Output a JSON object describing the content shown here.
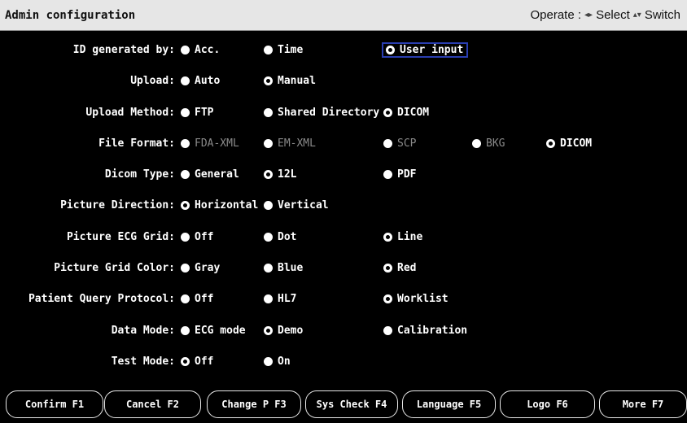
{
  "header": {
    "title": "Admin configuration",
    "operate_label": "Operate :",
    "select_label": "Select",
    "switch_label": "Switch",
    "select_icon": "left-right-arrows-icon",
    "switch_icon": "up-down-arrows-icon"
  },
  "settings": [
    {
      "label": "ID generated by:",
      "options": [
        {
          "text": "Acc.",
          "state": "filled"
        },
        {
          "text": "Time",
          "state": "filled"
        },
        {
          "text": "User input",
          "state": "selected",
          "focused": true
        }
      ]
    },
    {
      "label": "Upload:",
      "options": [
        {
          "text": "Auto",
          "state": "filled"
        },
        {
          "text": "Manual",
          "state": "selected"
        }
      ]
    },
    {
      "label": "Upload Method:",
      "options": [
        {
          "text": "FTP",
          "state": "filled"
        },
        {
          "text": "Shared Directory",
          "state": "filled"
        },
        {
          "text": "DICOM",
          "state": "selected"
        }
      ]
    },
    {
      "label": "File Format:",
      "options": [
        {
          "text": "FDA-XML",
          "state": "disabled"
        },
        {
          "text": "EM-XML",
          "state": "disabled"
        },
        {
          "text": "SCP",
          "state": "disabled"
        },
        {
          "text": "BKG",
          "state": "disabled"
        },
        {
          "text": "DICOM",
          "state": "selected"
        }
      ]
    },
    {
      "label": "Dicom Type:",
      "options": [
        {
          "text": "General",
          "state": "filled"
        },
        {
          "text": "12L",
          "state": "selected"
        },
        {
          "text": "PDF",
          "state": "filled"
        }
      ]
    },
    {
      "label": "Picture Direction:",
      "options": [
        {
          "text": "Horizontal",
          "state": "selected"
        },
        {
          "text": "Vertical",
          "state": "filled"
        }
      ]
    },
    {
      "label": "Picture ECG Grid:",
      "options": [
        {
          "text": "Off",
          "state": "filled"
        },
        {
          "text": "Dot",
          "state": "filled"
        },
        {
          "text": "Line",
          "state": "selected"
        }
      ]
    },
    {
      "label": "Picture Grid Color:",
      "options": [
        {
          "text": "Gray",
          "state": "filled"
        },
        {
          "text": "Blue",
          "state": "filled"
        },
        {
          "text": "Red",
          "state": "selected"
        }
      ]
    },
    {
      "label": "Patient Query Protocol:",
      "options": [
        {
          "text": "Off",
          "state": "filled"
        },
        {
          "text": "HL7",
          "state": "filled"
        },
        {
          "text": "Worklist",
          "state": "selected"
        }
      ]
    },
    {
      "label": "Data Mode:",
      "options": [
        {
          "text": "ECG mode",
          "state": "filled"
        },
        {
          "text": "Demo",
          "state": "selected"
        },
        {
          "text": "Calibration",
          "state": "filled"
        }
      ]
    },
    {
      "label": "Test Mode:",
      "options": [
        {
          "text": "Off",
          "state": "selected"
        },
        {
          "text": "On",
          "state": "filled"
        }
      ]
    }
  ],
  "buttons": [
    {
      "label": "Confirm F1"
    },
    {
      "label": "Cancel F2"
    },
    {
      "label": "Change P F3"
    },
    {
      "label": "Sys Check F4"
    },
    {
      "label": "Language F5"
    },
    {
      "label": "Logo F6"
    },
    {
      "label": "More F7"
    }
  ],
  "colors": {
    "background": "#000000",
    "title_bar": "#e6e6e6",
    "focus_outline": "#2a3eb1",
    "disabled_text": "#8a8a8a"
  }
}
